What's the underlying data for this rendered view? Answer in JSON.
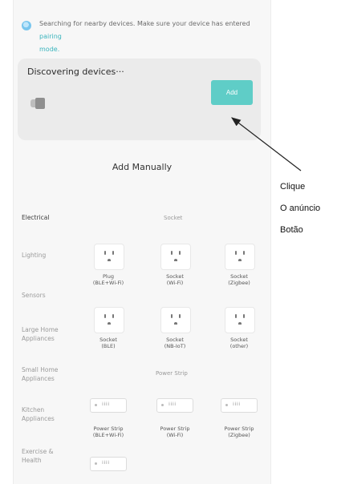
{
  "status": {
    "searching_text": "Searching for nearby devices. Make sure your device has entered ",
    "pairing_link": "pairing",
    "searching_suffix": " mode."
  },
  "discover": {
    "title": "Discovering devices···",
    "add_label": "Add"
  },
  "add_manually": {
    "title": "Add Manually"
  },
  "categories": [
    "Electrical",
    "Lighting",
    "Sensors",
    "Large Home Appliances",
    "Small Home Appliances",
    "Kitchen Appliances",
    "Exercise & Health"
  ],
  "active_category": "Electrical",
  "sections": [
    {
      "title": "Socket"
    },
    {
      "title": "Power Strip"
    }
  ],
  "sockets": [
    {
      "line1": "Plug",
      "line2": "(BLE+Wi-Fi)"
    },
    {
      "line1": "Socket",
      "line2": "(Wi-Fi)"
    },
    {
      "line1": "Socket",
      "line2": "(Zigbee)"
    },
    {
      "line1": "Socket",
      "line2": "(BLE)"
    },
    {
      "line1": "Socket",
      "line2": "(NB-IoT)"
    },
    {
      "line1": "Socket",
      "line2": "(other)"
    }
  ],
  "power_strips": [
    {
      "line1": "Power Strip",
      "line2": "(BLE+Wi-Fi)"
    },
    {
      "line1": "Power Strip",
      "line2": "(Wi-Fi)"
    },
    {
      "line1": "Power Strip",
      "line2": "(Zigbee)"
    }
  ],
  "annotation": {
    "line1": "Clique",
    "line2": "O anúncio",
    "line3": "Botão"
  },
  "colors": {
    "accent": "#5fcdc7",
    "link": "#3ab4bd",
    "card_bg": "#ebebeb"
  }
}
